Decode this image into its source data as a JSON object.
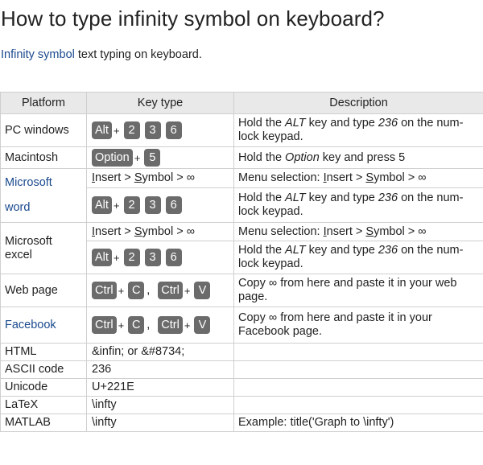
{
  "title": "How to type infinity symbol on keyboard?",
  "intro": {
    "link": "Infinity symbol",
    "rest": " text typing on keyboard."
  },
  "headers": {
    "platform": "Platform",
    "key": "Key type",
    "description": "Description"
  },
  "plus": "+",
  "comma": ",",
  "keys": {
    "alt": "Alt",
    "two": "2",
    "three": "3",
    "six": "6",
    "option": "Option",
    "five": "5",
    "ctrl": "Ctrl",
    "c": "C",
    "v": "V"
  },
  "menu": {
    "insert": "I",
    "insert_rest": "nsert",
    "gt": " > ",
    "symbol": "S",
    "symbol_rest": "ymbol",
    "inf": " > ∞"
  },
  "rows": {
    "pc": {
      "platform": "PC windows",
      "desc_a": "Hold the ",
      "desc_alt": "ALT",
      "desc_b": " key and type ",
      "desc_236": "236",
      "desc_c": " on the num-lock keypad."
    },
    "mac": {
      "platform": "Macintosh",
      "desc_a": "Hold the ",
      "desc_option": "Option",
      "desc_b": " key and press 5"
    },
    "word": {
      "platform_a": "Microsoft",
      "platform_b": "word",
      "menu_desc_prefix": "Menu selection: "
    },
    "excel": {
      "platform": "Microsoft excel"
    },
    "web": {
      "platform": "Web page",
      "desc": "Copy ∞ from here and paste it in your web page."
    },
    "facebook": {
      "platform": "Facebook",
      "desc": "Copy ∞ from here and paste it in your Facebook page."
    },
    "html": {
      "platform": "HTML",
      "key": "&infin; or &#8734;"
    },
    "ascii": {
      "platform": "ASCII code",
      "key": "236"
    },
    "unicode": {
      "platform": "Unicode",
      "key": "U+221E"
    },
    "latex": {
      "platform": "LaTeX",
      "key": "\\infty"
    },
    "matlab": {
      "platform": "MATLAB",
      "key": "\\infty",
      "desc": "Example: title('Graph to \\infty')"
    }
  }
}
